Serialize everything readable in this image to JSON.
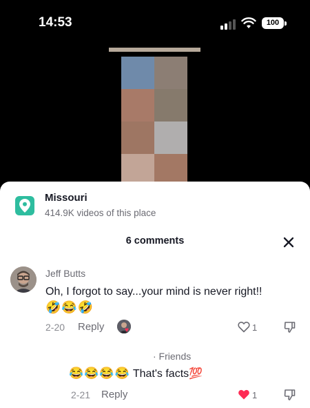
{
  "status_bar": {
    "time": "14:53",
    "battery": "100"
  },
  "place": {
    "name": "Missouri",
    "subtitle": "414.9K videos of this place"
  },
  "comments": {
    "header": "6 comments",
    "items": [
      {
        "author": "Jeff Butts",
        "text": "Oh, I forgot to say...your mind is never right!!",
        "emoji": "🤣😂🤣",
        "date": "2-20",
        "reply_label": "Reply",
        "likes": "1",
        "liked": false
      },
      {
        "label": "· Friends",
        "emoji": "😂😂😂😂",
        "text": "That's facts💯",
        "date": "2-21",
        "reply_label": "Reply",
        "likes": "1",
        "liked": true
      }
    ]
  },
  "colors": {
    "like_active": "#fe2c55",
    "place_icon": "#2ebd9f"
  },
  "icons": [
    "signal-icon",
    "wifi-icon",
    "battery-icon",
    "location-pin-icon",
    "close-icon",
    "heart-icon",
    "dislike-icon"
  ]
}
